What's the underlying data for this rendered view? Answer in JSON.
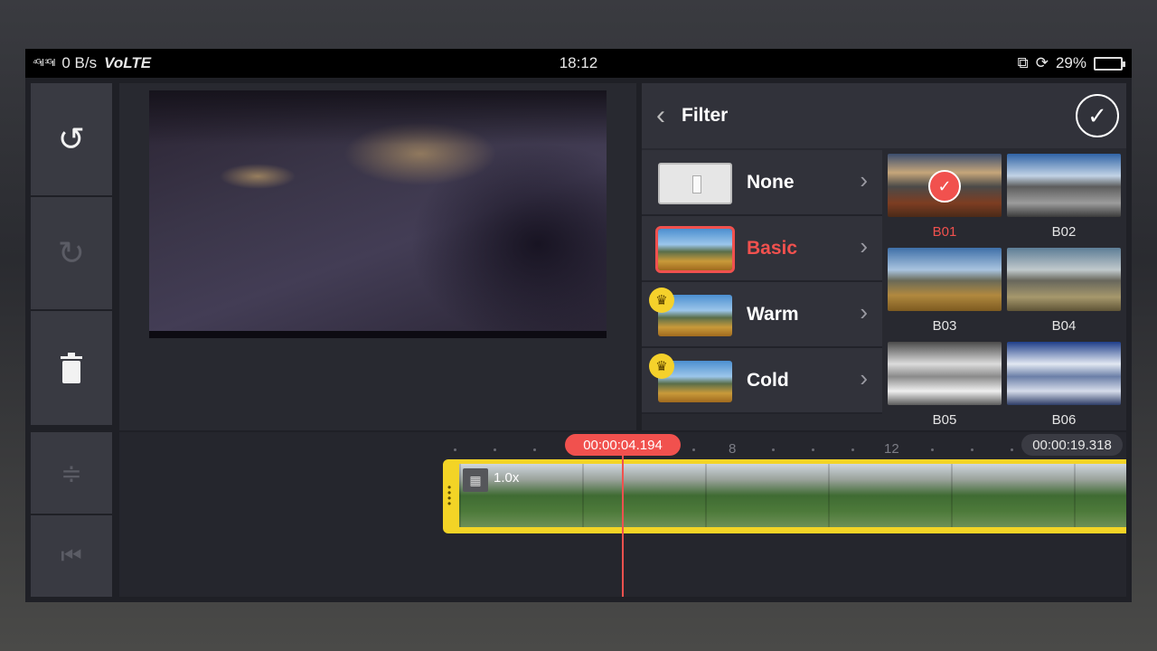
{
  "statusbar": {
    "signal": "⁴ᴳıl ³ᴳıl",
    "speed": "0 B/s",
    "network": "VoLTE",
    "time": "18:12",
    "battery": "29%",
    "battery_level": 0.29
  },
  "toolbar": {
    "undo_icon": "undo-icon",
    "redo_icon": "redo-icon",
    "delete_icon": "trash-icon",
    "split_icon": "split-icon",
    "goto_start_icon": "skip-to-start-icon"
  },
  "filter": {
    "title": "Filter",
    "categories": [
      {
        "label": "None",
        "premium": false,
        "selected": false
      },
      {
        "label": "Basic",
        "premium": false,
        "selected": true
      },
      {
        "label": "Warm",
        "premium": true,
        "selected": false
      },
      {
        "label": "Cold",
        "premium": true,
        "selected": false
      }
    ],
    "presets": [
      {
        "label": "B01",
        "selected": true
      },
      {
        "label": "B02",
        "selected": false
      },
      {
        "label": "B03",
        "selected": false
      },
      {
        "label": "B04",
        "selected": false
      },
      {
        "label": "B05",
        "selected": false
      },
      {
        "label": "B06",
        "selected": false
      }
    ]
  },
  "timeline": {
    "current_time": "00:00:04.194",
    "total_time": "00:00:19.318",
    "ticks": [
      "8",
      "12"
    ],
    "clip_speed": "1.0x"
  },
  "colors": {
    "accent": "#f1514e",
    "clip_border": "#f3d426",
    "panel": "#282930"
  }
}
